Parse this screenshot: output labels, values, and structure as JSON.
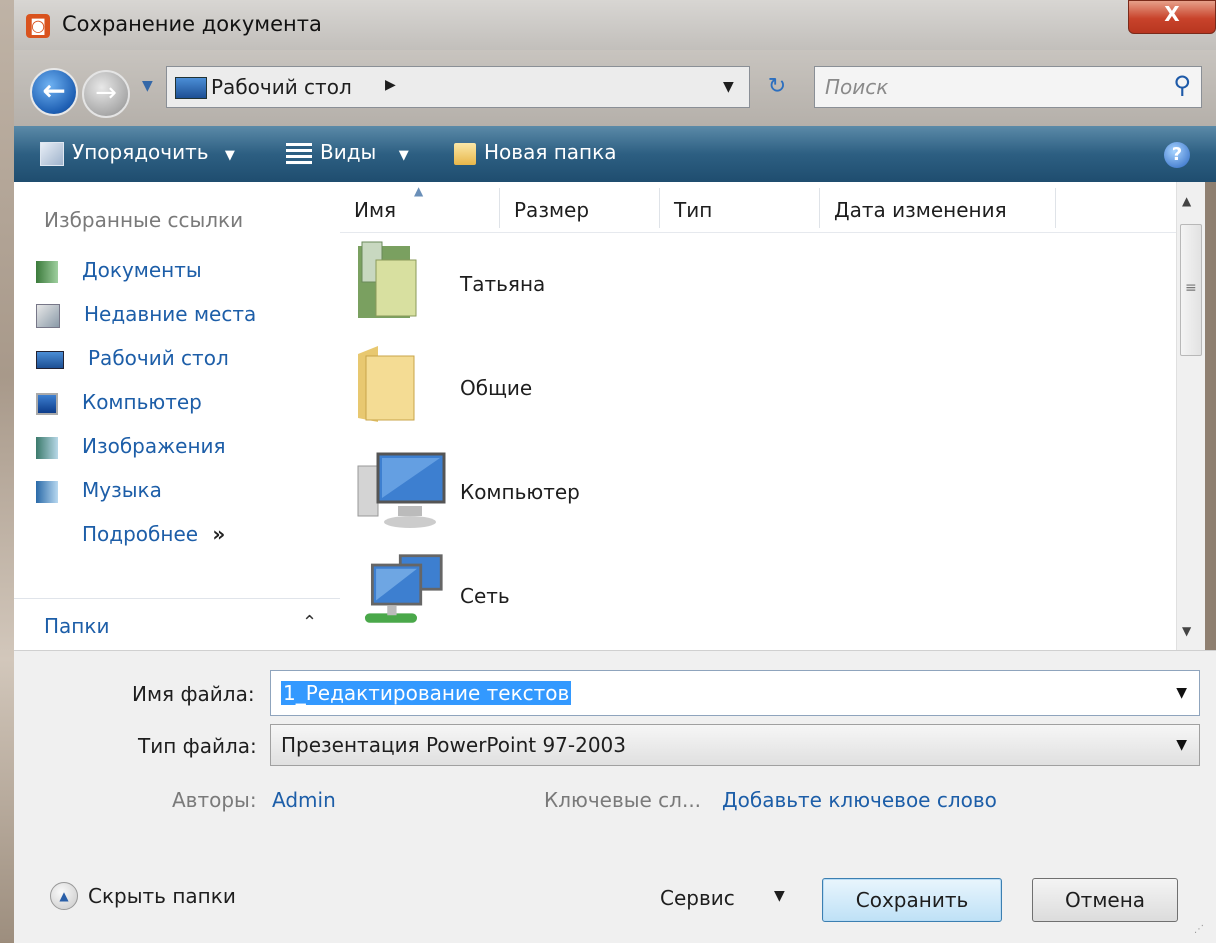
{
  "window": {
    "title": "Сохранение документа",
    "close_label": "X"
  },
  "nav": {
    "address": "Рабочий стол",
    "address_sep": "▶",
    "search_placeholder": "Поиск"
  },
  "toolbar": {
    "organize": "Упорядочить",
    "views": "Виды",
    "new_folder": "Новая папка",
    "dropdown_glyph": "▼"
  },
  "sidebar": {
    "heading": "Избранные ссылки",
    "items": [
      {
        "label": "Документы",
        "icon": "documents-icon"
      },
      {
        "label": "Недавние места",
        "icon": "recent-places-icon"
      },
      {
        "label": "Рабочий стол",
        "icon": "desktop-icon"
      },
      {
        "label": "Компьютер",
        "icon": "computer-icon"
      },
      {
        "label": "Изображения",
        "icon": "pictures-icon"
      },
      {
        "label": "Музыка",
        "icon": "music-icon"
      }
    ],
    "more": "Подробнее",
    "more_glyph": "»",
    "folders": "Папки"
  },
  "filelist": {
    "columns": [
      "Имя",
      "Размер",
      "Тип",
      "Дата изменения"
    ],
    "items": [
      {
        "label": "Татьяна",
        "icon": "user-folder-icon"
      },
      {
        "label": "Общие",
        "icon": "folder-icon"
      },
      {
        "label": "Компьютер",
        "icon": "computer-icon"
      },
      {
        "label": "Сеть",
        "icon": "network-icon"
      }
    ]
  },
  "form": {
    "filename_label": "Имя файла:",
    "filename_value": "1_Редактирование текстов",
    "filetype_label": "Тип файла:",
    "filetype_value": "Презентация PowerPoint 97-2003",
    "authors_label": "Авторы:",
    "authors_value": "Admin",
    "keywords_label": "Ключевые сл...",
    "keywords_value": "Добавьте ключевое слово"
  },
  "footer": {
    "hide_folders": "Скрыть папки",
    "service": "Сервис",
    "save": "Сохранить",
    "cancel": "Отмена"
  },
  "colors": {
    "toolbar": "#2d5f82",
    "link": "#1d5ea8",
    "selection": "#3399ff"
  }
}
